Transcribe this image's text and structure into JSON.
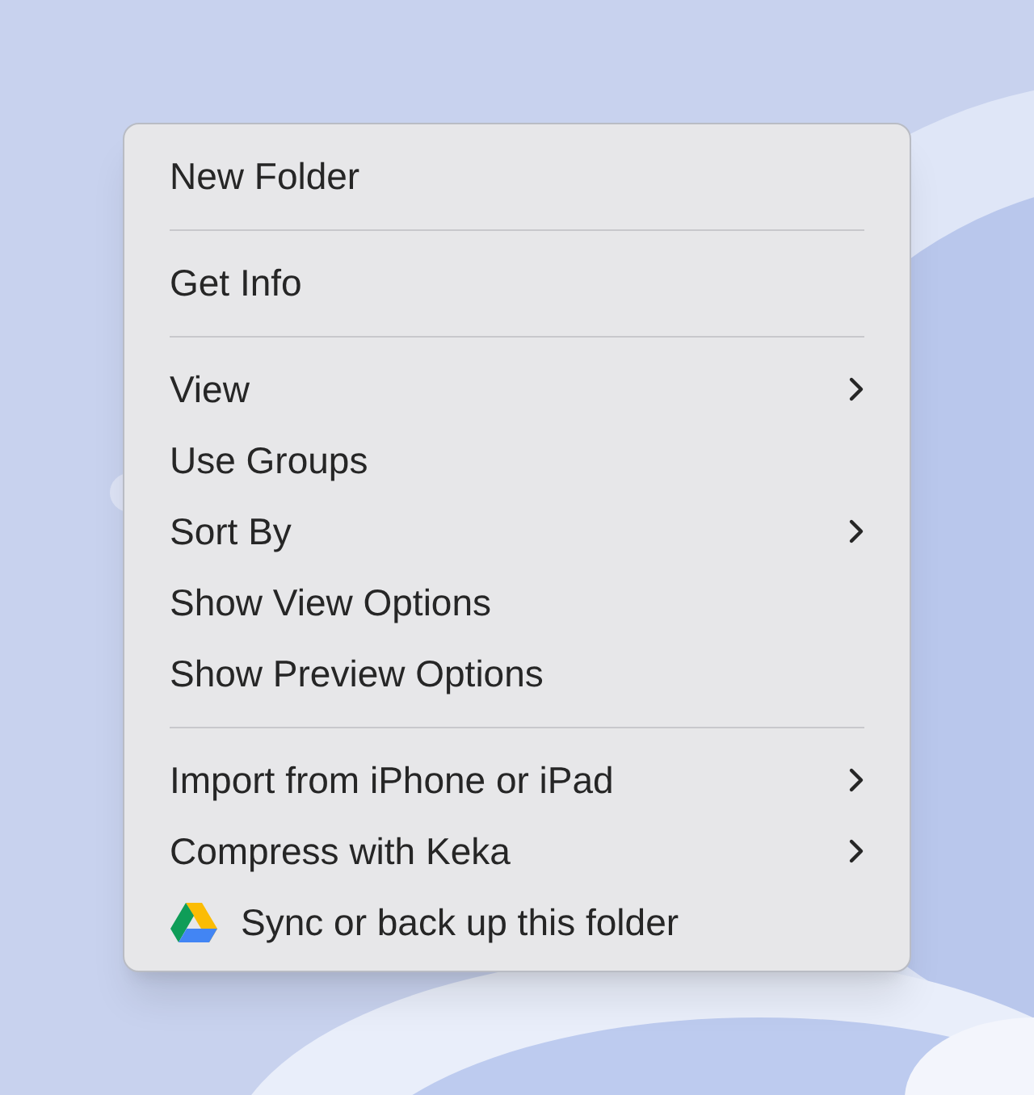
{
  "menu": {
    "sections": [
      {
        "items": [
          {
            "label": "New Folder",
            "submenu": false
          }
        ]
      },
      {
        "items": [
          {
            "label": "Get Info",
            "submenu": false
          }
        ]
      },
      {
        "items": [
          {
            "label": "View",
            "submenu": true
          },
          {
            "label": "Use Groups",
            "submenu": false
          },
          {
            "label": "Sort By",
            "submenu": true
          },
          {
            "label": "Show View Options",
            "submenu": false
          },
          {
            "label": "Show Preview Options",
            "submenu": false
          }
        ]
      },
      {
        "items": [
          {
            "label": "Import from iPhone or iPad",
            "submenu": true
          },
          {
            "label": "Compress with Keka",
            "submenu": true
          },
          {
            "label": "Sync or back up this folder",
            "submenu": false,
            "kind": "app"
          }
        ]
      }
    ]
  }
}
